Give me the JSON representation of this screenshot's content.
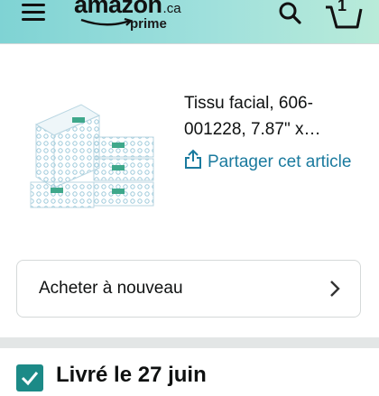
{
  "header": {
    "logo_word": "amazon",
    "logo_tld": ".ca",
    "logo_sub": "prime",
    "cart_count": "1",
    "menu_icon": "hamburger-menu-icon",
    "search_icon": "search-icon",
    "cart_icon": "cart-icon",
    "gradient_start": "#7fd3d4",
    "gradient_end": "#b9ebd9"
  },
  "product": {
    "title": "Tissu facial, 606-001228, 7.87\" x…",
    "share_label": "Partager cet article",
    "share_icon": "share-icon",
    "image_icon": "tissue-boxes-image",
    "link_color": "#1a7a9e"
  },
  "rebuy": {
    "label": "Acheter à nouveau",
    "chevron_icon": "chevron-right-icon"
  },
  "delivery": {
    "text": "Livré le 27 juin",
    "check_icon": "check-icon",
    "accent": "#1c8a87"
  }
}
